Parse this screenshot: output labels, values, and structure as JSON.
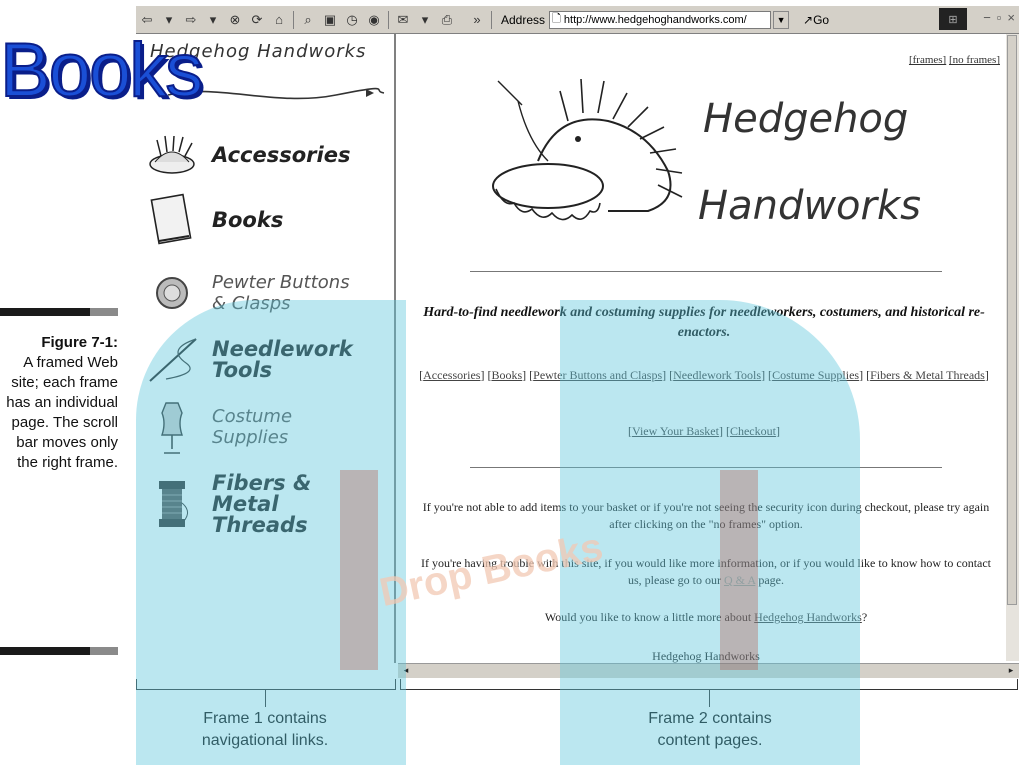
{
  "watermark": {
    "big_text": "Books",
    "center_text": "Drop Books"
  },
  "toolbar": {
    "address_label": "Address",
    "url": "http://www.hedgehoghandworks.com/",
    "go_label": "Go"
  },
  "nav_frame": {
    "title": "Hedgehog Handworks",
    "items": [
      {
        "label": "Accessories",
        "icon": "pincushion-icon"
      },
      {
        "label": "Books",
        "icon": "book-icon"
      },
      {
        "label": "Pewter Buttons & Clasps",
        "icon": "button-icon"
      },
      {
        "label": "Needlework Tools",
        "icon": "needle-icon"
      },
      {
        "label": "Costume Supplies",
        "icon": "dress-form-icon"
      },
      {
        "label": "Fibers & Metal Threads",
        "icon": "thread-spool-icon"
      }
    ]
  },
  "content_frame": {
    "frame_links": [
      "[frames]",
      "[no frames]"
    ],
    "logo_line1": "Hedgehog",
    "logo_line2": "Handworks",
    "tagline": "Hard-to-find needlework and costuming supplies for needleworkers, costumers, and historical re-enactors.",
    "category_links": [
      "Accessories",
      "Books",
      "Pewter Buttons and Clasps",
      "Needlework Tools",
      "Costume Supplies",
      "Fibers & Metal Threads"
    ],
    "basket_links": [
      "View Your Basket",
      "Checkout"
    ],
    "para1": "If you're not able to add items to your basket or if you're not seeing the security icon during checkout, please try again after clicking on  the \"no frames\" option.",
    "para2_pre": "If you're having trouble with this site, if you would like more information, or if you would like to know how to contact us, please go to our ",
    "para2_link": "Q & A",
    "para2_post": " page.",
    "para3_pre": "Would you like to know a little more about ",
    "para3_link": "Hedgehog Handworks",
    "para3_post": "?",
    "footer_name": "Hedgehog Handworks"
  },
  "figure": {
    "number": "Figure 7-1:",
    "caption": "A framed Web site; each frame has an individual page. The scroll bar moves only the right frame."
  },
  "annotations": {
    "frame1_line1": "Frame 1 contains",
    "frame1_line2": "navigational links.",
    "frame2_line1": "Frame 2 contains",
    "frame2_line2": "content pages."
  }
}
